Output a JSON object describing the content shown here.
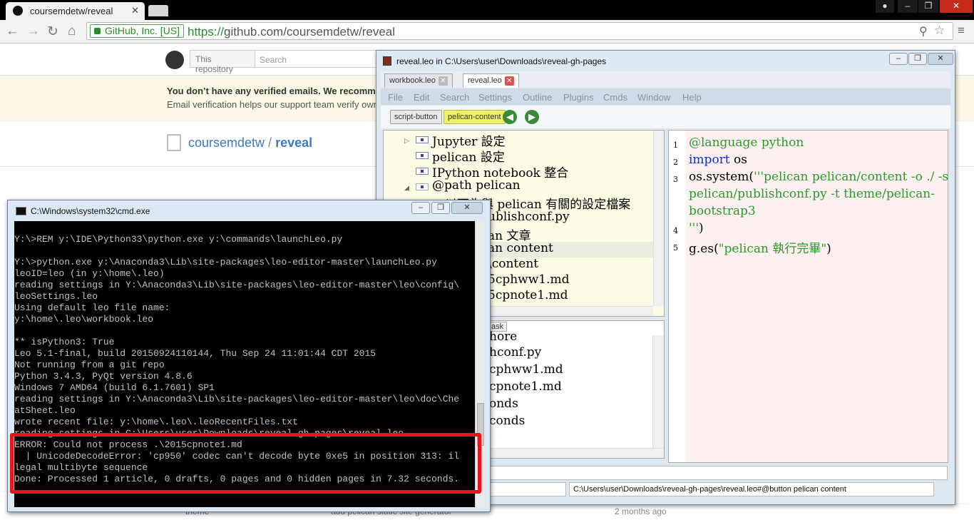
{
  "browser": {
    "tab_active_title": "coursemdetw/reveal",
    "ev_label": "GitHub, Inc. [US]",
    "url_scheme": "https://",
    "url_rest": "github.com/coursemdetw/reveal",
    "window_controls": [
      "–",
      "❐",
      "✕"
    ]
  },
  "github": {
    "scope_label": "This repository",
    "search_placeholder": "Search",
    "banner_line1": "You don’t have any verified emails. We recomm",
    "banner_line2": "Email verification helps our support team verify own",
    "repo_owner": "coursemdetw",
    "repo_sep": " / ",
    "repo_name": "reveal",
    "bottom_left": "theme",
    "bottom_mid": "add pelican static site generator",
    "bottom_right": "2 months ago"
  },
  "leo": {
    "title": "reveal.leo in C:\\Users\\user\\Downloads\\reveal-gh-pages",
    "tabs": [
      {
        "label": "workbook.leo"
      },
      {
        "label": "reveal.leo"
      }
    ],
    "menu": [
      "File",
      "Edit",
      "Search",
      "Settings",
      "Outline",
      "Plugins",
      "Cmds",
      "Window",
      "Help"
    ],
    "buttons": {
      "script": "script-button",
      "pelican": "pelican-content"
    },
    "outline": [
      "Jupyter 設定",
      "pelican 設定",
      "IPython notebook 整合",
      "@path pelican",
      "以下為與 pelican 有關的設定檔案",
      "ublishconf.py",
      "an 文章",
      "an content",
      "\\content",
      "5cphww1.md",
      "5cpnote1.md"
    ],
    "lower_tab": "ask",
    "lower_items": [
      "hore",
      "hconf.py",
      "cphww1.md",
      "cpnote1.md",
      "onds",
      "conds"
    ],
    "body_lines": [
      {
        "n": "1",
        "text": "@language python"
      },
      {
        "n": "2",
        "kw": "import",
        "rest": " os"
      },
      {
        "n": "3",
        "a": "os.system(",
        "b": "'''pelican pelican/content -o ./ -s"
      },
      {
        "n": "",
        "b": "pelican/publishconf.py -t theme/pelican-"
      },
      {
        "n": "",
        "b": "bootstrap3"
      },
      {
        "n": "4",
        "b": "'''",
        "a": ")"
      },
      {
        "n": "5",
        "a": "g.es(",
        "b": "\"pelican 執行完畢\"",
        "c": ")"
      }
    ],
    "status_path": "C:\\Users\\user\\Downloads\\reveal-gh-pages\\reveal.leo#@button pelican content"
  },
  "cmd": {
    "title": "C:\\Windows\\system32\\cmd.exe",
    "lines": [
      "Y:\\>REM y:\\IDE\\Python33\\python.exe y:\\commands\\launchLeo.py",
      "",
      "Y:\\>python.exe y:\\Anaconda3\\Lib\\site-packages\\leo-editor-master\\launchLeo.py",
      "leoID=leo (in y:\\home\\.leo)",
      "reading settings in Y:\\Anaconda3\\Lib\\site-packages\\leo-editor-master\\leo\\config\\",
      "leoSettings.leo",
      "Using default leo file name:",
      "y:\\home\\.leo\\workbook.leo",
      "",
      "** isPython3: True",
      "Leo 5.1-final, build 20150924110144, Thu Sep 24 11:01:44 CDT 2015",
      "Not running from a git repo",
      "Python 3.4.3, PyQt version 4.8.6",
      "Windows 7 AMD64 (build 6.1.7601) SP1",
      "reading settings in Y:\\Anaconda3\\Lib\\site-packages\\leo-editor-master\\leo\\doc\\Che",
      "atSheet.leo",
      "wrote recent file: y:\\home\\.leo\\.leoRecentFiles.txt",
      "reading settings in C:\\Users\\user\\Downloads\\reveal-gh-pages\\reveal.leo",
      "ERROR: Could not process .\\2015cpnote1.md",
      "  | UnicodeDecodeError: 'cp950' codec can't decode byte 0xe5 in position 313: il",
      "legal multibyte sequence",
      "Done: Processed 1 article, 0 drafts, 0 pages and 0 hidden pages in 7.32 seconds."
    ]
  }
}
